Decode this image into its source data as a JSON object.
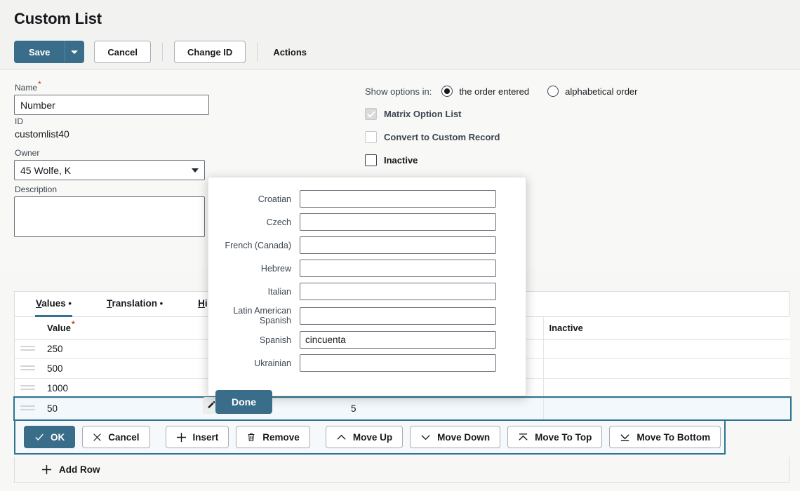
{
  "header": {
    "title": "Custom List",
    "save_label": "Save",
    "save_dropdown_icon": "caret-down-icon",
    "cancel_label": "Cancel",
    "change_id_label": "Change ID",
    "actions_label": "Actions"
  },
  "form": {
    "name_label": "Name",
    "name_required": "*",
    "name_value": "Number",
    "name_placeholder": "",
    "id_label": "ID",
    "id_value": "customlist40",
    "owner_label": "Owner",
    "owner_value": "45 Wolfe, K",
    "description_label": "Description",
    "description_value": "",
    "description_placeholder": ""
  },
  "options": {
    "show_options_label": "Show options in:",
    "order_entered_label": "the order entered",
    "order_entered_selected": true,
    "alphabetical_label": "alphabetical order",
    "alphabetical_selected": false,
    "matrix_label": "Matrix Option List",
    "matrix_checked": true,
    "matrix_disabled": true,
    "convert_label": "Convert to Custom Record",
    "convert_checked": false,
    "convert_disabled": true,
    "inactive_label": "Inactive",
    "inactive_checked": false
  },
  "tabs": [
    {
      "key": "values",
      "accesskey": "V",
      "rest": "alues",
      "dot": " •",
      "active": true
    },
    {
      "key": "translation",
      "accesskey": "T",
      "rest": "ranslation",
      "dot": " •",
      "active": false
    },
    {
      "key": "history",
      "accesskey": "H",
      "rest": "istory",
      "dot": "",
      "active": false
    }
  ],
  "table": {
    "col_value_label": "Value",
    "col_value_required": "*",
    "col_inactive_label": "Inactive",
    "rows": [
      {
        "value": "250",
        "mid": "",
        "inactive": "",
        "selected": false
      },
      {
        "value": "500",
        "mid": "",
        "inactive": "",
        "selected": false
      },
      {
        "value": "1000",
        "mid": "",
        "inactive": "",
        "selected": false
      },
      {
        "value": "50",
        "mid": "5",
        "inactive": "",
        "selected": true
      }
    ]
  },
  "row_toolbar": {
    "ok_label": "OK",
    "ok_icon": "check-icon",
    "cancel_label": "Cancel",
    "cancel_icon": "x-icon",
    "insert_label": "Insert",
    "insert_icon": "plus-icon",
    "remove_label": "Remove",
    "remove_icon": "trash-icon",
    "move_up_label": "Move Up",
    "move_up_icon": "chevron-up-icon",
    "move_down_label": "Move Down",
    "move_down_icon": "chevron-down-icon",
    "move_top_label": "Move To Top",
    "move_top_icon": "chevron-up-bar-icon",
    "move_bottom_label": "Move To Bottom",
    "move_bottom_icon": "chevron-down-bar-icon"
  },
  "add_row": {
    "label": "Add Row",
    "icon": "plus-icon"
  },
  "modal": {
    "fields": [
      {
        "label": "Croatian",
        "value": ""
      },
      {
        "label": "Czech",
        "value": ""
      },
      {
        "label": "French (Canada)",
        "value": ""
      },
      {
        "label": "Hebrew",
        "value": ""
      },
      {
        "label": "Italian",
        "value": ""
      },
      {
        "label": "Latin American Spanish",
        "value": ""
      },
      {
        "label": "Spanish",
        "value": "cincuenta"
      },
      {
        "label": "Ukrainian",
        "value": ""
      }
    ],
    "done_label": "Done"
  },
  "colors": {
    "accent": "#3a6d8a",
    "tab_underline": "#2e7390",
    "selected_row_bg": "#f2f8fb",
    "required_star": "#c0392b"
  }
}
